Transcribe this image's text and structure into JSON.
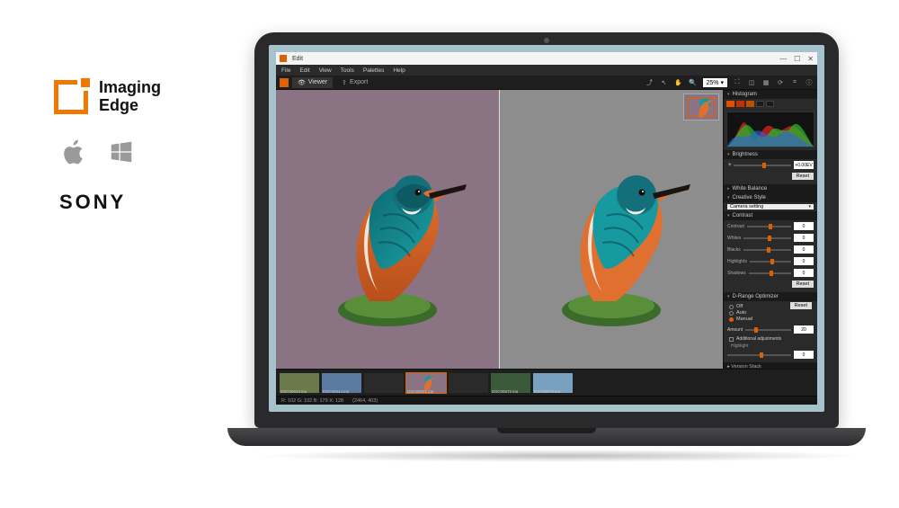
{
  "branding": {
    "product_line1": "Imaging",
    "product_line2": "Edge",
    "company": "SONY"
  },
  "titlebar": {
    "title": "Edit"
  },
  "menubar": [
    "File",
    "Edit",
    "View",
    "Tools",
    "Palettes",
    "Help"
  ],
  "tabs": {
    "viewer": "Viewer",
    "export": "Export"
  },
  "toolbar": {
    "zoom_value": "25%",
    "zoom_dropdown_arrow": "▾"
  },
  "panels": {
    "histogram": "Histogram",
    "brightness": {
      "title": "Brightness",
      "value": "+0.00EV",
      "reset": "Reset"
    },
    "white_balance": "White Balance",
    "creative_style": {
      "title": "Creative Style",
      "value": "Camera setting"
    },
    "contrast": {
      "title": "Contrast",
      "rows": [
        "Contrast",
        "Whites",
        "Blacks",
        "Highlights",
        "Shadows"
      ],
      "reset": "Reset"
    },
    "dro": {
      "title": "D-Range Optimizer",
      "off": "Off",
      "auto": "Auto",
      "manual": "Manual",
      "amount": "Amount",
      "amount_value": "20",
      "additional": "Additional adjustments",
      "highlight": "Highlight",
      "reset": "Reset"
    },
    "version_stack": "Version Stack"
  },
  "filmstrip": {
    "thumbs": [
      "DSC00643.jpg",
      "DSC00644.jpg",
      "",
      "DSC00651.jpg",
      "",
      "DSC00672.jpg",
      "DSC00673.jpg"
    ]
  },
  "statusbar": {
    "rgb": "R: 102  G: 102  B: 179  X: 128",
    "dims": "(2464, 403)"
  },
  "colors": {
    "accent": "#e06000"
  }
}
